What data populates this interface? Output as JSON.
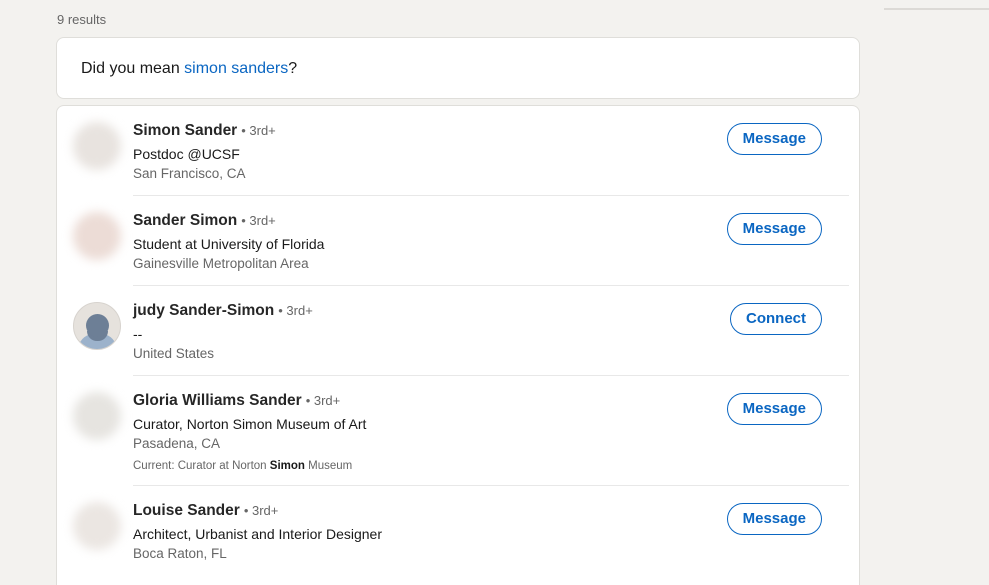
{
  "results_count": "9 results",
  "suggestion": {
    "prefix": "Did you mean ",
    "term": "simon sanders",
    "suffix": "?"
  },
  "people": [
    {
      "name": "Simon Sander",
      "degree": "• 3rd+",
      "headline": "Postdoc @UCSF",
      "location": "San Francisco, CA",
      "action": "Message"
    },
    {
      "name": "Sander Simon",
      "degree": "• 3rd+",
      "headline": "Student at University of Florida",
      "location": "Gainesville Metropolitan Area",
      "action": "Message"
    },
    {
      "name": "judy Sander-Simon",
      "degree": "• 3rd+",
      "headline": "--",
      "location": "United States",
      "action": "Connect"
    },
    {
      "name": "Gloria Williams Sander",
      "degree": "• 3rd+",
      "headline": "Curator, Norton Simon Museum of Art",
      "location": "Pasadena, CA",
      "summary": {
        "prefix": "Current: Curator at Norton ",
        "highlight": "Simon",
        "suffix": " Museum"
      },
      "action": "Message"
    },
    {
      "name": "Louise Sander",
      "degree": "• 3rd+",
      "headline": "Architect, Urbanist and Interior Designer",
      "location": "Boca Raton, FL",
      "action": "Message"
    }
  ],
  "colors": {
    "accent": "#0a66c2",
    "page_background": "#f3f2ef",
    "card_background": "#ffffff",
    "secondary_text": "#666666"
  }
}
